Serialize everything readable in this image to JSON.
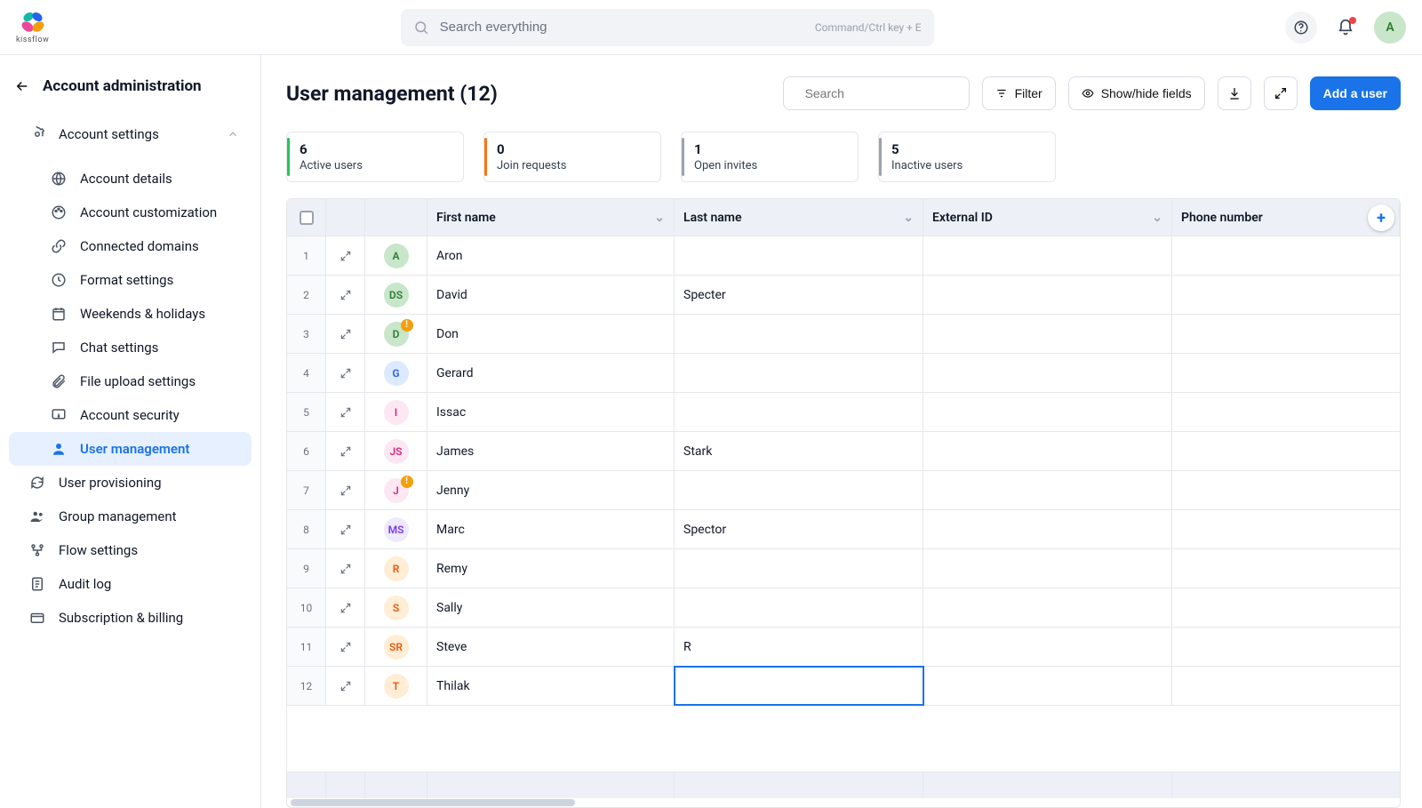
{
  "brand": {
    "name": "kissflow"
  },
  "search": {
    "placeholder": "Search everything",
    "hint": "Command/Ctrl key + E"
  },
  "topbar": {
    "avatar_letter": "A"
  },
  "sidebar": {
    "title": "Account administration",
    "section": "Account settings",
    "items": [
      {
        "icon": "globe",
        "label": "Account details"
      },
      {
        "icon": "palette",
        "label": "Account customization"
      },
      {
        "icon": "link",
        "label": "Connected domains"
      },
      {
        "icon": "clock",
        "label": "Format settings"
      },
      {
        "icon": "calendar",
        "label": "Weekends & holidays"
      },
      {
        "icon": "chat",
        "label": "Chat settings"
      },
      {
        "icon": "attach",
        "label": "File upload settings"
      },
      {
        "icon": "security",
        "label": "Account security"
      },
      {
        "icon": "user",
        "label": "User management"
      },
      {
        "icon": "sync",
        "label": "User provisioning"
      },
      {
        "icon": "group",
        "label": "Group management"
      },
      {
        "icon": "flow",
        "label": "Flow settings"
      },
      {
        "icon": "audit",
        "label": "Audit log"
      },
      {
        "icon": "billing",
        "label": "Subscription & billing"
      }
    ],
    "active_index": 8,
    "indent_end_index": 8
  },
  "page": {
    "title": "User management (12)",
    "search_placeholder": "Search",
    "buttons": {
      "filter": "Filter",
      "fields": "Show/hide fields",
      "add": "Add a user"
    }
  },
  "stats": [
    {
      "value": "6",
      "label": "Active users",
      "accent": "green"
    },
    {
      "value": "0",
      "label": "Join requests",
      "accent": "orange"
    },
    {
      "value": "1",
      "label": "Open invites",
      "accent": "gray"
    },
    {
      "value": "5",
      "label": "Inactive users",
      "accent": "gray2"
    }
  ],
  "table": {
    "columns": [
      "First name",
      "Last name",
      "External ID",
      "Phone number"
    ],
    "rows": [
      {
        "i": 1,
        "initials": "A",
        "avatar_bg": "#c8e6c9",
        "avatar_fg": "#2e7d32",
        "first": "Aron",
        "last": "",
        "warn": false
      },
      {
        "i": 2,
        "initials": "DS",
        "avatar_bg": "#c8e6c9",
        "avatar_fg": "#2e7d32",
        "first": "David",
        "last": "Specter",
        "warn": false
      },
      {
        "i": 3,
        "initials": "D",
        "avatar_bg": "#c8e6c9",
        "avatar_fg": "#2e7d32",
        "first": "Don",
        "last": "",
        "warn": true
      },
      {
        "i": 4,
        "initials": "G",
        "avatar_bg": "#dbeafe",
        "avatar_fg": "#2563eb",
        "first": "Gerard",
        "last": "",
        "warn": false
      },
      {
        "i": 5,
        "initials": "I",
        "avatar_bg": "#fce7f3",
        "avatar_fg": "#db2777",
        "first": "Issac",
        "last": "",
        "warn": false
      },
      {
        "i": 6,
        "initials": "JS",
        "avatar_bg": "#fce7f3",
        "avatar_fg": "#db2777",
        "first": "James",
        "last": "Stark",
        "warn": false
      },
      {
        "i": 7,
        "initials": "J",
        "avatar_bg": "#fce7f3",
        "avatar_fg": "#db2777",
        "first": "Jenny",
        "last": "",
        "warn": true
      },
      {
        "i": 8,
        "initials": "MS",
        "avatar_bg": "#ede9fe",
        "avatar_fg": "#7c3aed",
        "first": "Marc",
        "last": "Spector",
        "warn": false
      },
      {
        "i": 9,
        "initials": "R",
        "avatar_bg": "#ffedd5",
        "avatar_fg": "#ea580c",
        "first": "Remy",
        "last": "",
        "warn": false
      },
      {
        "i": 10,
        "initials": "S",
        "avatar_bg": "#ffedd5",
        "avatar_fg": "#ea580c",
        "first": "Sally",
        "last": "",
        "warn": false
      },
      {
        "i": 11,
        "initials": "SR",
        "avatar_bg": "#ffedd5",
        "avatar_fg": "#ea580c",
        "first": "Steve",
        "last": "R",
        "warn": false
      },
      {
        "i": 12,
        "initials": "T",
        "avatar_bg": "#ffedd5",
        "avatar_fg": "#ea580c",
        "first": "Thilak",
        "last": "",
        "warn": false
      }
    ],
    "selected_cell": {
      "row": 12,
      "col": "last"
    }
  }
}
